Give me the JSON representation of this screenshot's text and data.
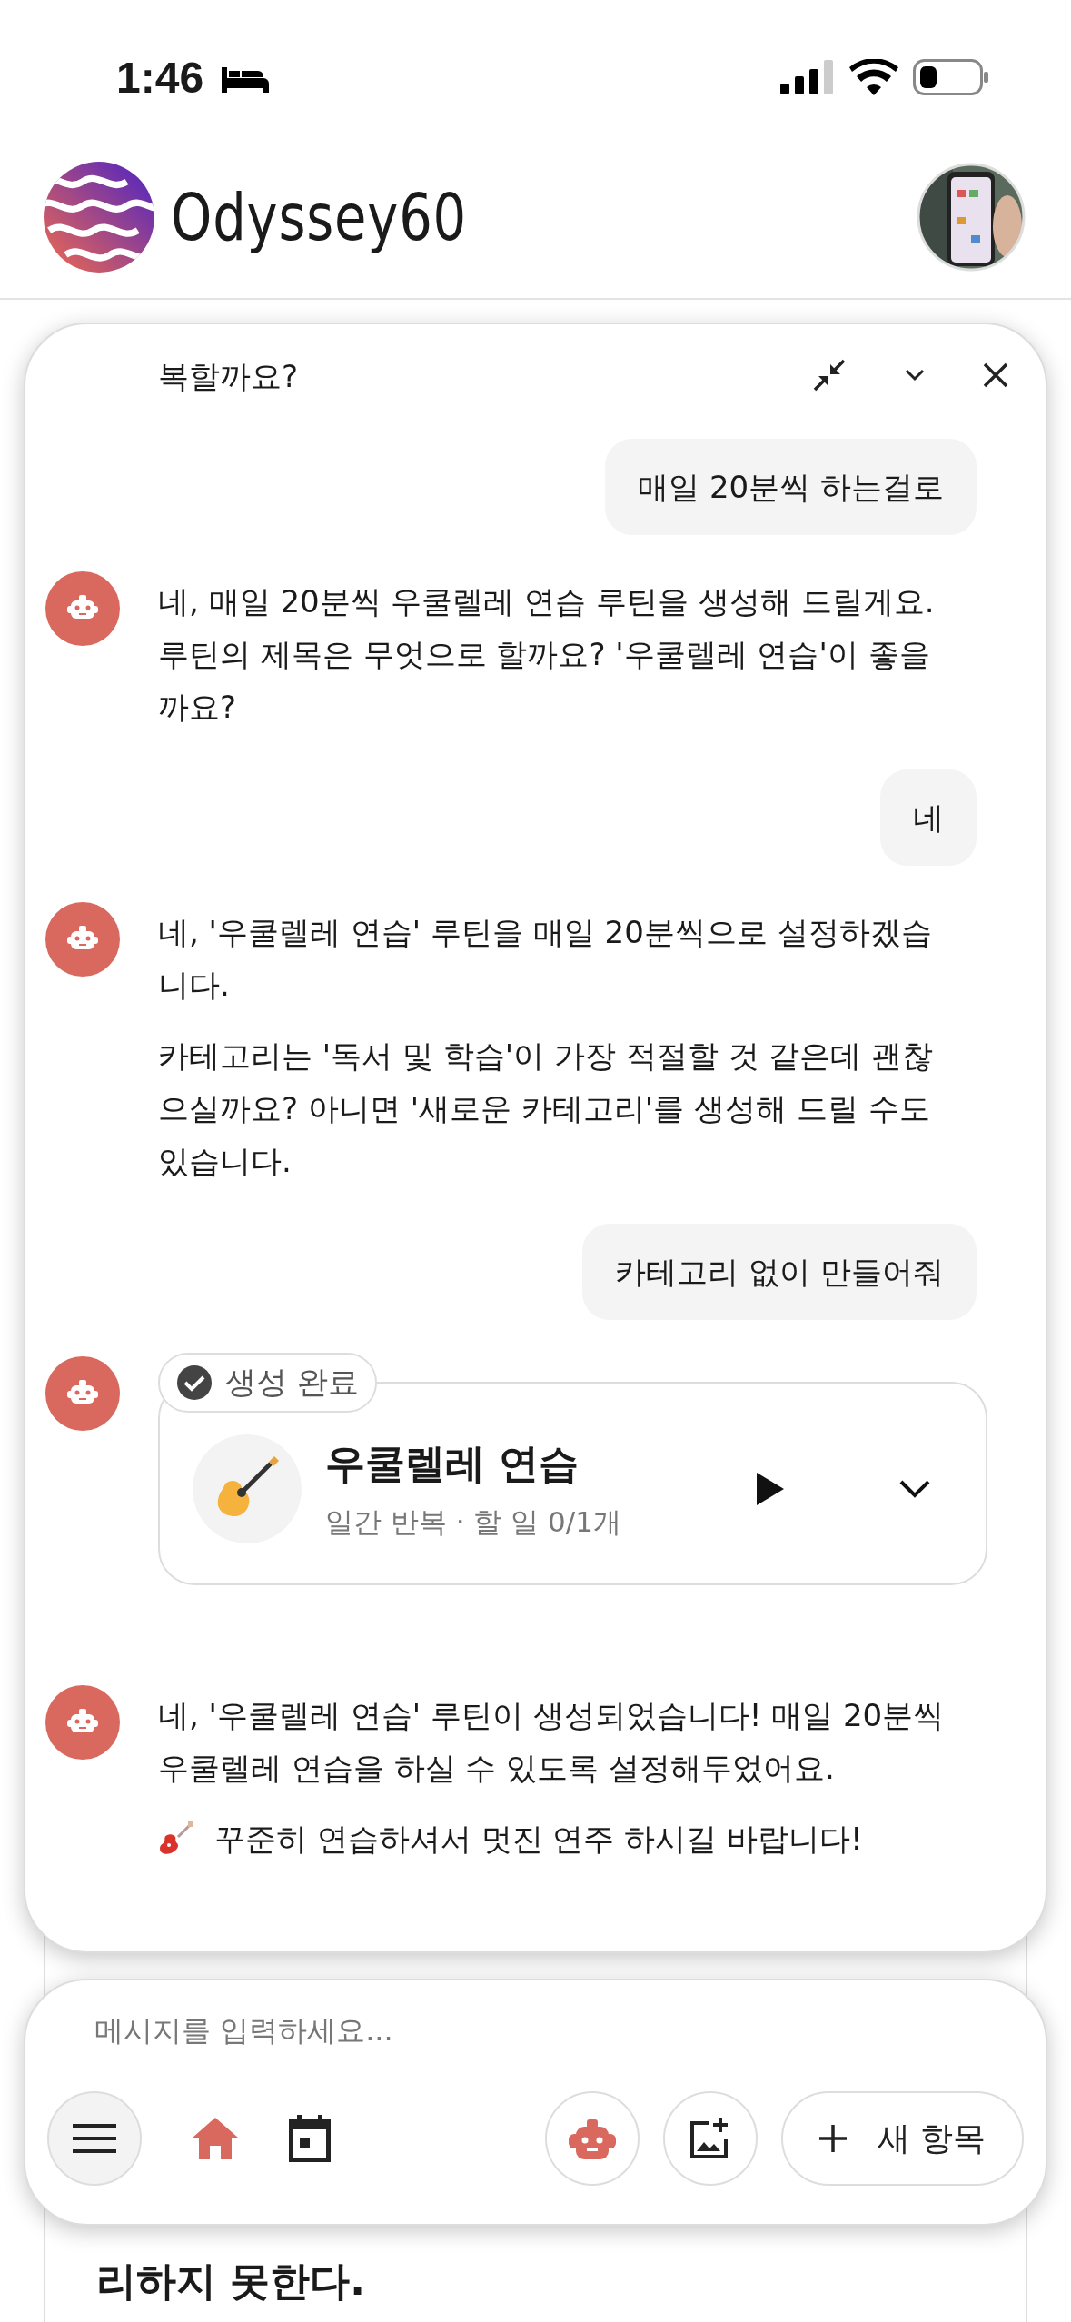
{
  "status_bar": {
    "time": "1:46"
  },
  "header": {
    "app_name": "Odyssey60"
  },
  "background_card": {
    "text": "리하지 못한다."
  },
  "chat": {
    "messages": [
      {
        "kind": "bot_fragment",
        "paragraphs": [
          "복할까요?"
        ]
      },
      {
        "kind": "user",
        "text": "매일 20분씩 하는걸로"
      },
      {
        "kind": "bot",
        "paragraphs": [
          "네, 매일 20분씩 우쿨렐레 연습 루틴을 생성해 드릴게요. 루틴의 제목은 무엇으로 할까요? '우쿨렐레 연습'이 좋을까요?"
        ]
      },
      {
        "kind": "user",
        "text": "네"
      },
      {
        "kind": "bot",
        "paragraphs": [
          "네, '우쿨렐레 연습' 루틴을 매일 20분씩으로 설정하겠습니다.",
          "카테고리는 '독서 및 학습'이 가장 적절할 것 같은데 괜찮으실까요? 아니면 '새로운 카테고리'를 생성해 드릴 수도 있습니다."
        ]
      },
      {
        "kind": "user",
        "text": "카테고리 없이 만들어줘"
      },
      {
        "kind": "routine_card",
        "badge": "생성 완료",
        "title": "우쿨렐레 연습",
        "subtitle": "일간 반복 · 할 일 0/1개",
        "expanded": false
      },
      {
        "kind": "bot",
        "paragraphs": [
          "네, '우쿨렐레 연습' 루틴이 생성되었습니다! 매일 20분씩 우쿨렐레 연습을 하실 수 있도록 설정해두었어요."
        ],
        "closing": "꾸준히 연습하셔서 멋진 연주 하시길 바랍니다!"
      }
    ]
  },
  "composer": {
    "placeholder": "메시지를 입력하세요...",
    "nav": [
      {
        "kind": "home",
        "selected": true
      },
      {
        "kind": "calendar",
        "selected": false
      }
    ],
    "new_button": "새 항목"
  }
}
